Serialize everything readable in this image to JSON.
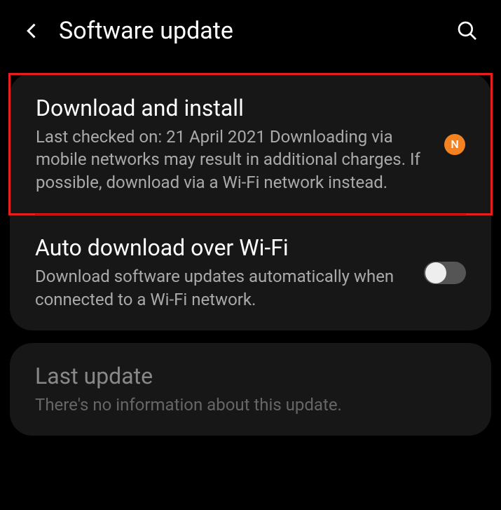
{
  "header": {
    "title": "Software update"
  },
  "card1": {
    "download": {
      "title": "Download and install",
      "desc": "Last checked on: 21 April 2021\nDownloading via mobile networks may result in additional charges. If possible, download via a Wi-Fi network instead.",
      "badge": "N"
    },
    "auto": {
      "title": "Auto download over Wi-Fi",
      "desc": "Download software updates automatically when connected to a Wi-Fi network."
    }
  },
  "card2": {
    "last": {
      "title": "Last update",
      "desc": "There's no information about this update."
    }
  }
}
